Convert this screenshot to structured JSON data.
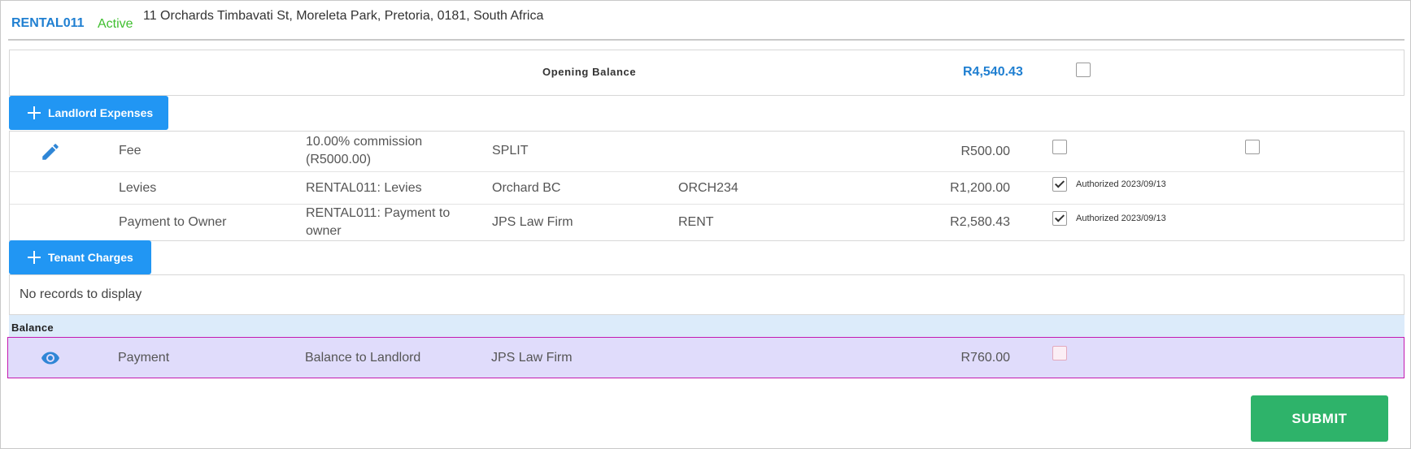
{
  "header": {
    "rental_id": "RENTAL011",
    "status": "Active",
    "address": "11 Orchards Timbavati St, Moreleta Park, Pretoria, 0181, South Africa"
  },
  "opening_balance": {
    "label": "Opening Balance",
    "amount": "R4,540.43"
  },
  "landlord_expenses": {
    "button_label": "Landlord Expenses",
    "rows": [
      {
        "type": "Fee",
        "description_line1": "10.00% commission",
        "description_line2": "(R5000.00)",
        "payee": "SPLIT",
        "reference": "",
        "amount": "R500.00",
        "authorized": false,
        "authorized_text": ""
      },
      {
        "type": "Levies",
        "description_line1": "RENTAL011: Levies",
        "description_line2": "",
        "payee": "Orchard BC",
        "reference": "ORCH234",
        "amount": "R1,200.00",
        "authorized": true,
        "authorized_text": "Authorized 2023/09/13"
      },
      {
        "type": "Payment to Owner",
        "description_line1": "RENTAL011: Payment to",
        "description_line2": "owner",
        "payee": "JPS Law Firm",
        "reference": "RENT",
        "amount": "R2,580.43",
        "authorized": true,
        "authorized_text": "Authorized 2023/09/13"
      }
    ]
  },
  "tenant_charges": {
    "button_label": "Tenant Charges",
    "empty_text": "No records to display"
  },
  "balance": {
    "label": "Balance",
    "row": {
      "type": "Payment",
      "description": "Balance to Landlord",
      "payee": "JPS Law Firm",
      "amount": "R760.00"
    }
  },
  "submit_label": "SUBMIT",
  "icons": {
    "edit": "pencil-icon",
    "view": "eye-icon",
    "add": "plus-icon"
  },
  "colors": {
    "accent_blue": "#2196f3",
    "link_blue": "#1f7fd1",
    "active_green": "#3fbf2f",
    "submit_green": "#2eb36a",
    "balance_band": "#dcebfa",
    "selected_row": "#e0dcfb",
    "selected_border": "#c41ab0"
  }
}
